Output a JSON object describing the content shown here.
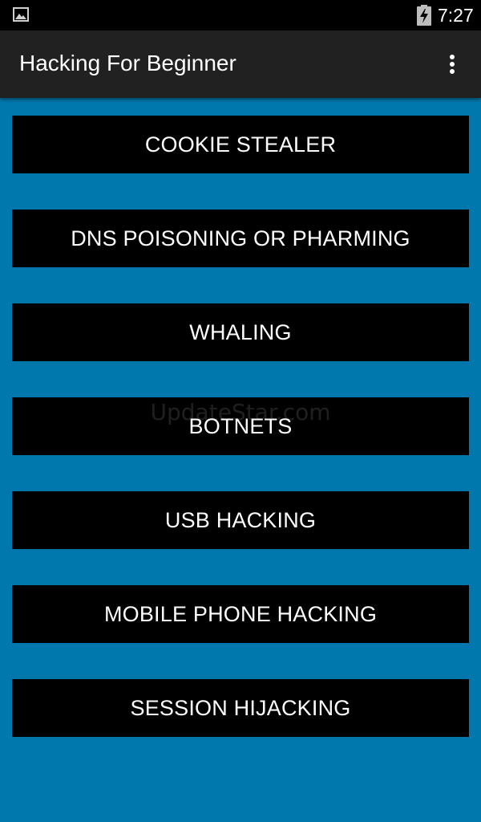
{
  "status_bar": {
    "time": "7:27",
    "left_icon": "image-icon",
    "battery_icon": "battery-charging-icon"
  },
  "app_bar": {
    "title": "Hacking For Beginner",
    "overflow_icon": "more-vert-icon"
  },
  "menu": {
    "items": [
      {
        "label": "COOKIE STEALER"
      },
      {
        "label": "DNS POISONING OR PHARMING"
      },
      {
        "label": "WHALING"
      },
      {
        "label": "BOTNETS"
      },
      {
        "label": "USB HACKING"
      },
      {
        "label": "MOBILE PHONE HACKING"
      },
      {
        "label": "SESSION HIJACKING"
      }
    ]
  },
  "watermark": "UpdateStar.com",
  "colors": {
    "background": "#0077ad",
    "app_bar": "#212121",
    "status_bar": "#000000",
    "button": "#000000",
    "text": "#ffffff"
  }
}
